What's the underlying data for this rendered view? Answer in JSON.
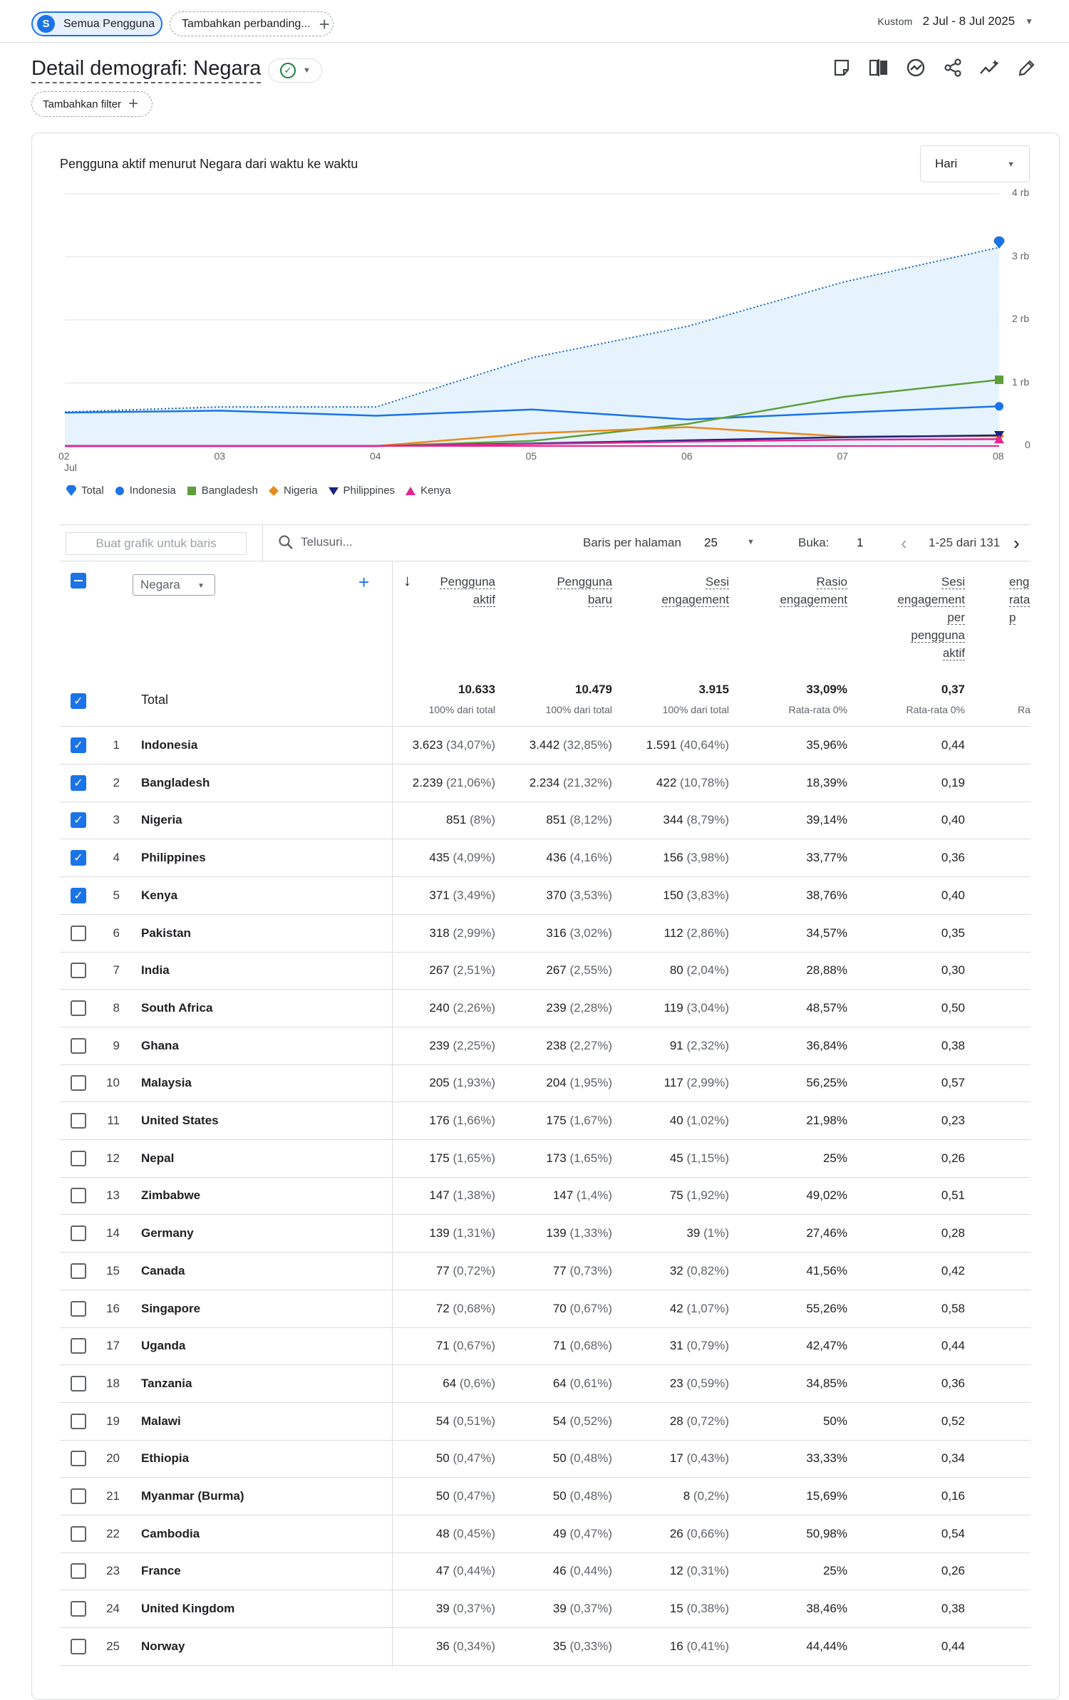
{
  "topbar": {
    "segment_avatar": "S",
    "segment_label": "Semua Pengguna",
    "compare_label": "Tambahkan perbanding...",
    "date_prefix": "Kustom",
    "date_range": "2 Jul - 8 Jul 2025"
  },
  "page": {
    "title": "Detail demografi: Negara",
    "add_filter": "Tambahkan filter"
  },
  "toolbar_icons": [
    "bookmark-icon",
    "compare-icon",
    "insights-icon",
    "share-icon",
    "trend-icon",
    "edit-icon"
  ],
  "chart_card": {
    "title": "Pengguna aktif menurut Negara dari waktu ke waktu",
    "granularity": "Hari"
  },
  "chart_data": {
    "type": "line",
    "x": [
      "02 Jul",
      "03",
      "04",
      "05",
      "06",
      "07",
      "08"
    ],
    "x_tick_labels": [
      "02",
      "03",
      "04",
      "05",
      "06",
      "07",
      "08"
    ],
    "x_sub_label": "Jul",
    "y_ticks": [
      "4 rb",
      "3 rb",
      "2 rb",
      "1 rb",
      "0"
    ],
    "ylim": [
      0,
      4000
    ],
    "series": [
      {
        "name": "Total",
        "color": "#1a73e8",
        "marker": "pin",
        "style": "dotted-area",
        "values": [
          540,
          620,
          620,
          1400,
          1900,
          2600,
          3150
        ]
      },
      {
        "name": "Indonesia",
        "color": "#1a73e8",
        "marker": "circle",
        "values": [
          530,
          560,
          480,
          580,
          420,
          530,
          630
        ]
      },
      {
        "name": "Bangladesh",
        "color": "#5f9e3a",
        "marker": "square",
        "values": [
          0,
          0,
          0,
          80,
          350,
          780,
          1050
        ]
      },
      {
        "name": "Nigeria",
        "color": "#e8891c",
        "marker": "diamond",
        "values": [
          0,
          0,
          0,
          200,
          300,
          150,
          160
        ]
      },
      {
        "name": "Philippines",
        "color": "#1a237e",
        "marker": "triangle-down",
        "values": [
          0,
          0,
          0,
          40,
          90,
          140,
          170
        ]
      },
      {
        "name": "Kenya",
        "color": "#e52592",
        "marker": "triangle-up",
        "values": [
          0,
          0,
          0,
          30,
          70,
          100,
          110
        ]
      }
    ],
    "legend": "bottom-left",
    "grid": true
  },
  "table": {
    "dim_filter_placeholder": "Buat grafik untuk baris",
    "search_placeholder": "Telusuri...",
    "rows_per_page_label": "Baris per halaman",
    "rows_per_page": "25",
    "goto_label": "Buka:",
    "goto_value": "1",
    "range_text": "1-25 dari 131",
    "dimension": "Negara",
    "columns": [
      {
        "lines": [
          "Pengguna",
          "aktif"
        ]
      },
      {
        "lines": [
          "Pengguna",
          "baru"
        ]
      },
      {
        "lines": [
          "Sesi",
          "engagement"
        ]
      },
      {
        "lines": [
          "Rasio",
          "engagement"
        ]
      },
      {
        "lines": [
          "Sesi",
          "engagement",
          "per",
          "pengguna",
          "aktif"
        ]
      },
      {
        "lines": [
          "eng",
          "rata",
          "p"
        ]
      }
    ],
    "totals": {
      "label": "Total",
      "values": [
        "10.633",
        "10.479",
        "3.915",
        "33,09%",
        "0,37"
      ],
      "subs": [
        "100% dari total",
        "100% dari total",
        "100% dari total",
        "Rata-rata 0%",
        "Rata-rata 0%",
        "Ra"
      ]
    },
    "rows": [
      {
        "idx": "1",
        "country": "Indonesia",
        "checked": true,
        "active": "3.623",
        "active_pct": "(34,07%)",
        "new": "3.442",
        "new_pct": "(32,85%)",
        "sessions": "1.591",
        "sessions_pct": "(40,64%)",
        "rate": "35,96%",
        "per_user": "0,44"
      },
      {
        "idx": "2",
        "country": "Bangladesh",
        "checked": true,
        "active": "2.239",
        "active_pct": "(21,06%)",
        "new": "2.234",
        "new_pct": "(21,32%)",
        "sessions": "422",
        "sessions_pct": "(10,78%)",
        "rate": "18,39%",
        "per_user": "0,19"
      },
      {
        "idx": "3",
        "country": "Nigeria",
        "checked": true,
        "active": "851",
        "active_pct": "(8%)",
        "new": "851",
        "new_pct": "(8,12%)",
        "sessions": "344",
        "sessions_pct": "(8,79%)",
        "rate": "39,14%",
        "per_user": "0,40"
      },
      {
        "idx": "4",
        "country": "Philippines",
        "checked": true,
        "active": "435",
        "active_pct": "(4,09%)",
        "new": "436",
        "new_pct": "(4,16%)",
        "sessions": "156",
        "sessions_pct": "(3,98%)",
        "rate": "33,77%",
        "per_user": "0,36"
      },
      {
        "idx": "5",
        "country": "Kenya",
        "checked": true,
        "active": "371",
        "active_pct": "(3,49%)",
        "new": "370",
        "new_pct": "(3,53%)",
        "sessions": "150",
        "sessions_pct": "(3,83%)",
        "rate": "38,76%",
        "per_user": "0,40"
      },
      {
        "idx": "6",
        "country": "Pakistan",
        "checked": false,
        "active": "318",
        "active_pct": "(2,99%)",
        "new": "316",
        "new_pct": "(3,02%)",
        "sessions": "112",
        "sessions_pct": "(2,86%)",
        "rate": "34,57%",
        "per_user": "0,35"
      },
      {
        "idx": "7",
        "country": "India",
        "checked": false,
        "active": "267",
        "active_pct": "(2,51%)",
        "new": "267",
        "new_pct": "(2,55%)",
        "sessions": "80",
        "sessions_pct": "(2,04%)",
        "rate": "28,88%",
        "per_user": "0,30"
      },
      {
        "idx": "8",
        "country": "South Africa",
        "checked": false,
        "active": "240",
        "active_pct": "(2,26%)",
        "new": "239",
        "new_pct": "(2,28%)",
        "sessions": "119",
        "sessions_pct": "(3,04%)",
        "rate": "48,57%",
        "per_user": "0,50"
      },
      {
        "idx": "9",
        "country": "Ghana",
        "checked": false,
        "active": "239",
        "active_pct": "(2,25%)",
        "new": "238",
        "new_pct": "(2,27%)",
        "sessions": "91",
        "sessions_pct": "(2,32%)",
        "rate": "36,84%",
        "per_user": "0,38"
      },
      {
        "idx": "10",
        "country": "Malaysia",
        "checked": false,
        "active": "205",
        "active_pct": "(1,93%)",
        "new": "204",
        "new_pct": "(1,95%)",
        "sessions": "117",
        "sessions_pct": "(2,99%)",
        "rate": "56,25%",
        "per_user": "0,57"
      },
      {
        "idx": "11",
        "country": "United States",
        "checked": false,
        "active": "176",
        "active_pct": "(1,66%)",
        "new": "175",
        "new_pct": "(1,67%)",
        "sessions": "40",
        "sessions_pct": "(1,02%)",
        "rate": "21,98%",
        "per_user": "0,23"
      },
      {
        "idx": "12",
        "country": "Nepal",
        "checked": false,
        "active": "175",
        "active_pct": "(1,65%)",
        "new": "173",
        "new_pct": "(1,65%)",
        "sessions": "45",
        "sessions_pct": "(1,15%)",
        "rate": "25%",
        "per_user": "0,26"
      },
      {
        "idx": "13",
        "country": "Zimbabwe",
        "checked": false,
        "active": "147",
        "active_pct": "(1,38%)",
        "new": "147",
        "new_pct": "(1,4%)",
        "sessions": "75",
        "sessions_pct": "(1,92%)",
        "rate": "49,02%",
        "per_user": "0,51"
      },
      {
        "idx": "14",
        "country": "Germany",
        "checked": false,
        "active": "139",
        "active_pct": "(1,31%)",
        "new": "139",
        "new_pct": "(1,33%)",
        "sessions": "39",
        "sessions_pct": "(1%)",
        "rate": "27,46%",
        "per_user": "0,28"
      },
      {
        "idx": "15",
        "country": "Canada",
        "checked": false,
        "active": "77",
        "active_pct": "(0,72%)",
        "new": "77",
        "new_pct": "(0,73%)",
        "sessions": "32",
        "sessions_pct": "(0,82%)",
        "rate": "41,56%",
        "per_user": "0,42"
      },
      {
        "idx": "16",
        "country": "Singapore",
        "checked": false,
        "active": "72",
        "active_pct": "(0,68%)",
        "new": "70",
        "new_pct": "(0,67%)",
        "sessions": "42",
        "sessions_pct": "(1,07%)",
        "rate": "55,26%",
        "per_user": "0,58"
      },
      {
        "idx": "17",
        "country": "Uganda",
        "checked": false,
        "active": "71",
        "active_pct": "(0,67%)",
        "new": "71",
        "new_pct": "(0,68%)",
        "sessions": "31",
        "sessions_pct": "(0,79%)",
        "rate": "42,47%",
        "per_user": "0,44"
      },
      {
        "idx": "18",
        "country": "Tanzania",
        "checked": false,
        "active": "64",
        "active_pct": "(0,6%)",
        "new": "64",
        "new_pct": "(0,61%)",
        "sessions": "23",
        "sessions_pct": "(0,59%)",
        "rate": "34,85%",
        "per_user": "0,36"
      },
      {
        "idx": "19",
        "country": "Malawi",
        "checked": false,
        "active": "54",
        "active_pct": "(0,51%)",
        "new": "54",
        "new_pct": "(0,52%)",
        "sessions": "28",
        "sessions_pct": "(0,72%)",
        "rate": "50%",
        "per_user": "0,52"
      },
      {
        "idx": "20",
        "country": "Ethiopia",
        "checked": false,
        "active": "50",
        "active_pct": "(0,47%)",
        "new": "50",
        "new_pct": "(0,48%)",
        "sessions": "17",
        "sessions_pct": "(0,43%)",
        "rate": "33,33%",
        "per_user": "0,34"
      },
      {
        "idx": "21",
        "country": "Myanmar (Burma)",
        "checked": false,
        "active": "50",
        "active_pct": "(0,47%)",
        "new": "50",
        "new_pct": "(0,48%)",
        "sessions": "8",
        "sessions_pct": "(0,2%)",
        "rate": "15,69%",
        "per_user": "0,16"
      },
      {
        "idx": "22",
        "country": "Cambodia",
        "checked": false,
        "active": "48",
        "active_pct": "(0,45%)",
        "new": "49",
        "new_pct": "(0,47%)",
        "sessions": "26",
        "sessions_pct": "(0,66%)",
        "rate": "50,98%",
        "per_user": "0,54"
      },
      {
        "idx": "23",
        "country": "France",
        "checked": false,
        "active": "47",
        "active_pct": "(0,44%)",
        "new": "46",
        "new_pct": "(0,44%)",
        "sessions": "12",
        "sessions_pct": "(0,31%)",
        "rate": "25%",
        "per_user": "0,26"
      },
      {
        "idx": "24",
        "country": "United Kingdom",
        "checked": false,
        "active": "39",
        "active_pct": "(0,37%)",
        "new": "39",
        "new_pct": "(0,37%)",
        "sessions": "15",
        "sessions_pct": "(0,38%)",
        "rate": "38,46%",
        "per_user": "0,38"
      },
      {
        "idx": "25",
        "country": "Norway",
        "checked": false,
        "active": "36",
        "active_pct": "(0,34%)",
        "new": "35",
        "new_pct": "(0,33%)",
        "sessions": "16",
        "sessions_pct": "(0,41%)",
        "rate": "44,44%",
        "per_user": "0,44"
      }
    ]
  }
}
